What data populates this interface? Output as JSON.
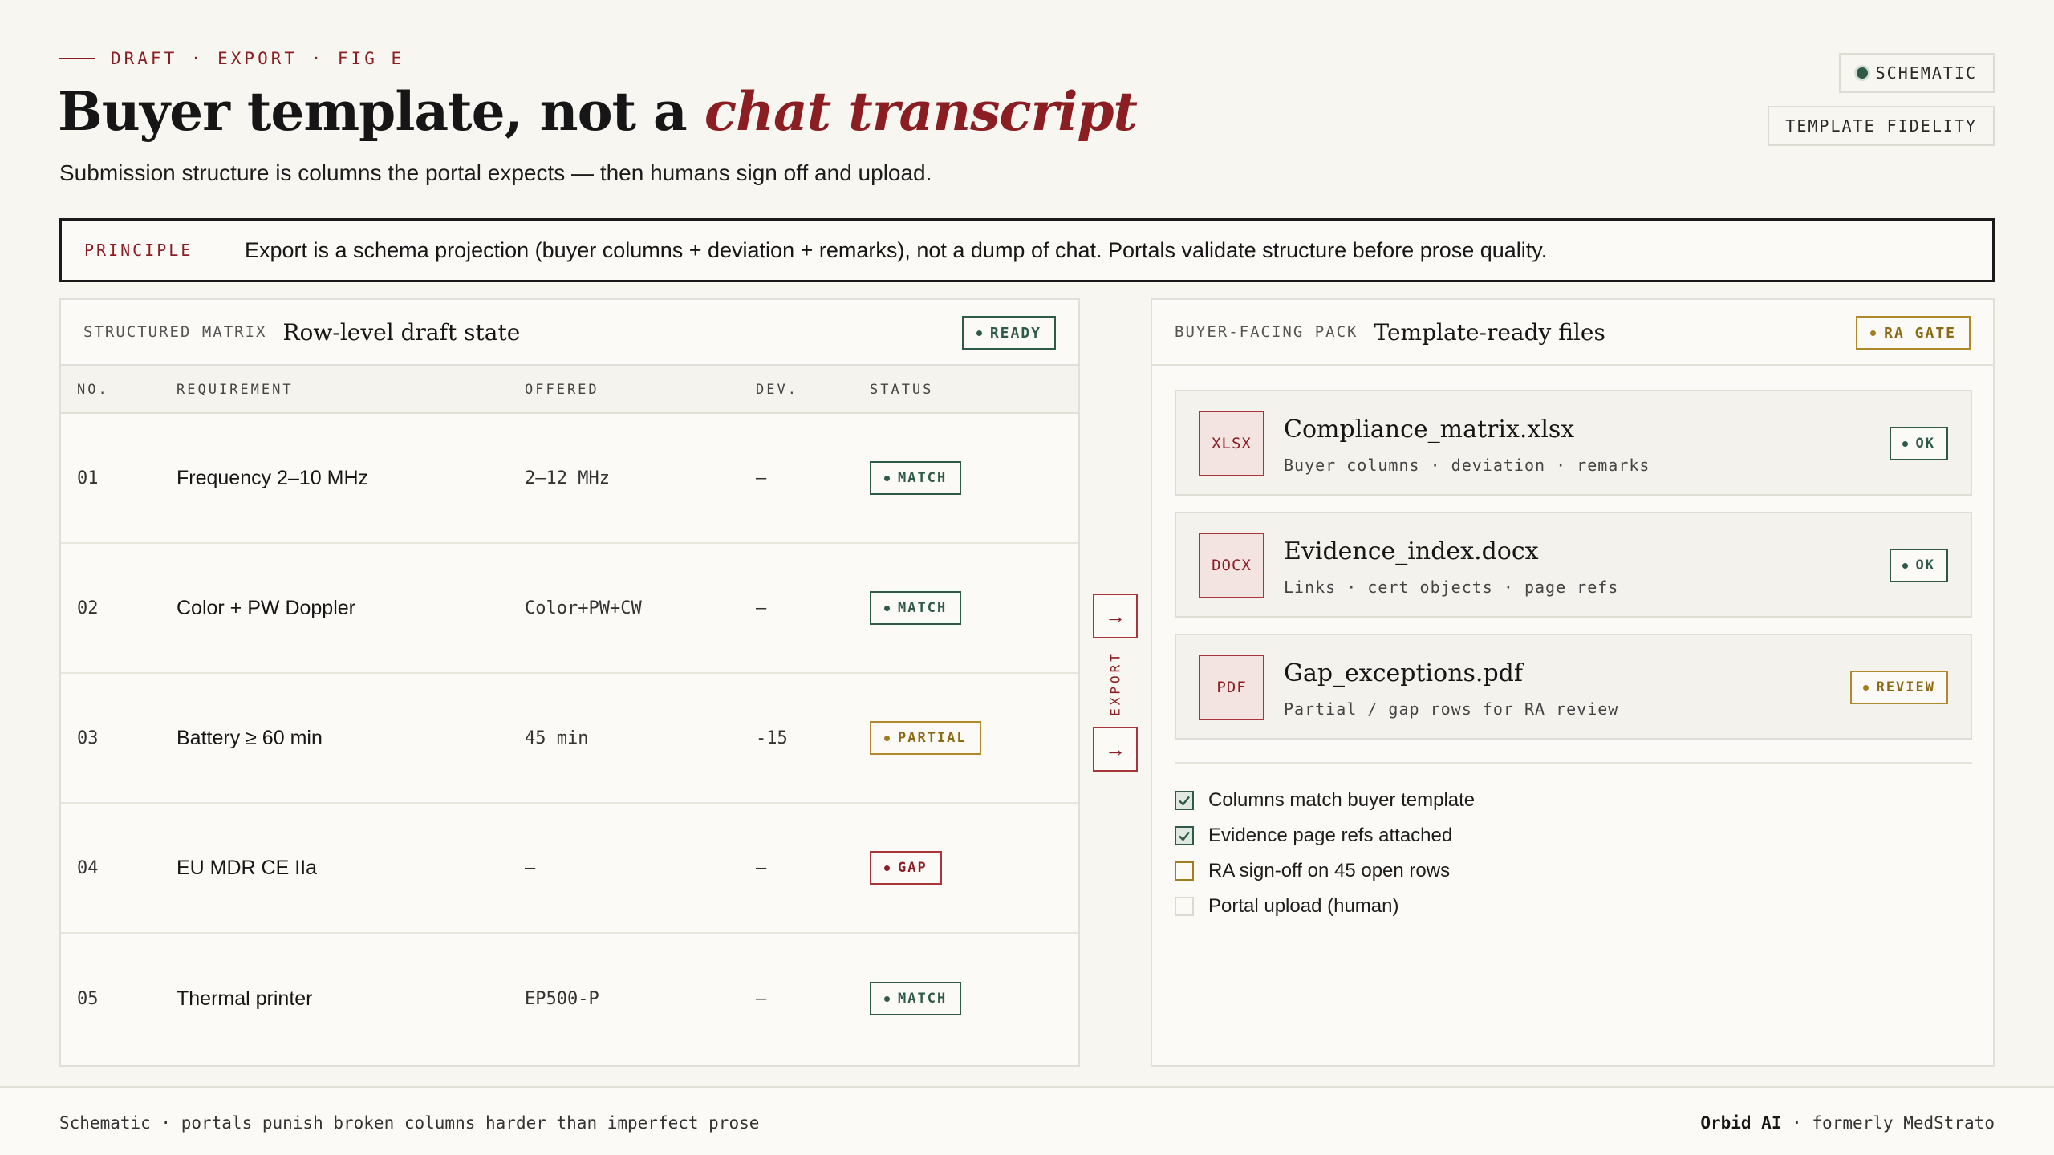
{
  "header": {
    "eyebrow": "DRAFT · EXPORT · FIG E",
    "title_main": "Buyer template, not a ",
    "title_accent": "chat transcript",
    "subtitle": "Submission structure is columns the portal expects — then humans sign off and upload.",
    "tag_schematic": "SCHEMATIC",
    "tag_fidelity": "TEMPLATE FIDELITY"
  },
  "principle": {
    "label": "PRINCIPLE",
    "text": "Export is a schema projection (buyer columns + deviation + remarks), not a dump of chat. Portals validate structure before prose quality."
  },
  "matrix": {
    "kicker": "STRUCTURED MATRIX",
    "title": "Row-level draft state",
    "badge": "READY",
    "columns": [
      "NO.",
      "REQUIREMENT",
      "OFFERED",
      "DEV.",
      "STATUS"
    ],
    "rows": [
      {
        "no": "01",
        "requirement": "Frequency 2–10 MHz",
        "offered": "2–12 MHz",
        "dev": "—",
        "status": "MATCH"
      },
      {
        "no": "02",
        "requirement": "Color + PW Doppler",
        "offered": "Color+PW+CW",
        "dev": "—",
        "status": "MATCH"
      },
      {
        "no": "03",
        "requirement": "Battery ≥ 60 min",
        "offered": "45 min",
        "dev": "-15",
        "status": "PARTIAL"
      },
      {
        "no": "04",
        "requirement": "EU MDR CE IIa",
        "offered": "—",
        "dev": "—",
        "status": "GAP"
      },
      {
        "no": "05",
        "requirement": "Thermal printer",
        "offered": "EP500-P",
        "dev": "—",
        "status": "MATCH"
      }
    ]
  },
  "connector": {
    "label": "EXPORT",
    "arrow": "→"
  },
  "pack": {
    "kicker": "BUYER-FACING PACK",
    "title": "Template-ready files",
    "badge": "RA GATE",
    "files": [
      {
        "type": "XLSX",
        "name": "Compliance_matrix.xlsx",
        "desc": "Buyer columns · deviation · remarks",
        "status": "OK"
      },
      {
        "type": "DOCX",
        "name": "Evidence_index.docx",
        "desc": "Links · cert objects · page refs",
        "status": "OK"
      },
      {
        "type": "PDF",
        "name": "Gap_exceptions.pdf",
        "desc": "Partial / gap rows for RA review",
        "status": "REVIEW"
      }
    ],
    "checklist": [
      {
        "label": "Columns match buyer template",
        "state": "done"
      },
      {
        "label": "Evidence page refs attached",
        "state": "done"
      },
      {
        "label": "RA sign-off on 45 open rows",
        "state": "pending"
      },
      {
        "label": "Portal upload (human)",
        "state": "empty"
      }
    ]
  },
  "footer": {
    "left": "Schematic · portals punish broken columns harder than imperfect prose",
    "brand": "Orbid AI",
    "right": " · formerly MedStrato"
  },
  "colors": {
    "accent_red": "#8b1e22",
    "ok_green": "#2f5a47",
    "warn_gold": "#a07d1e",
    "background": "#f8f6f0"
  }
}
